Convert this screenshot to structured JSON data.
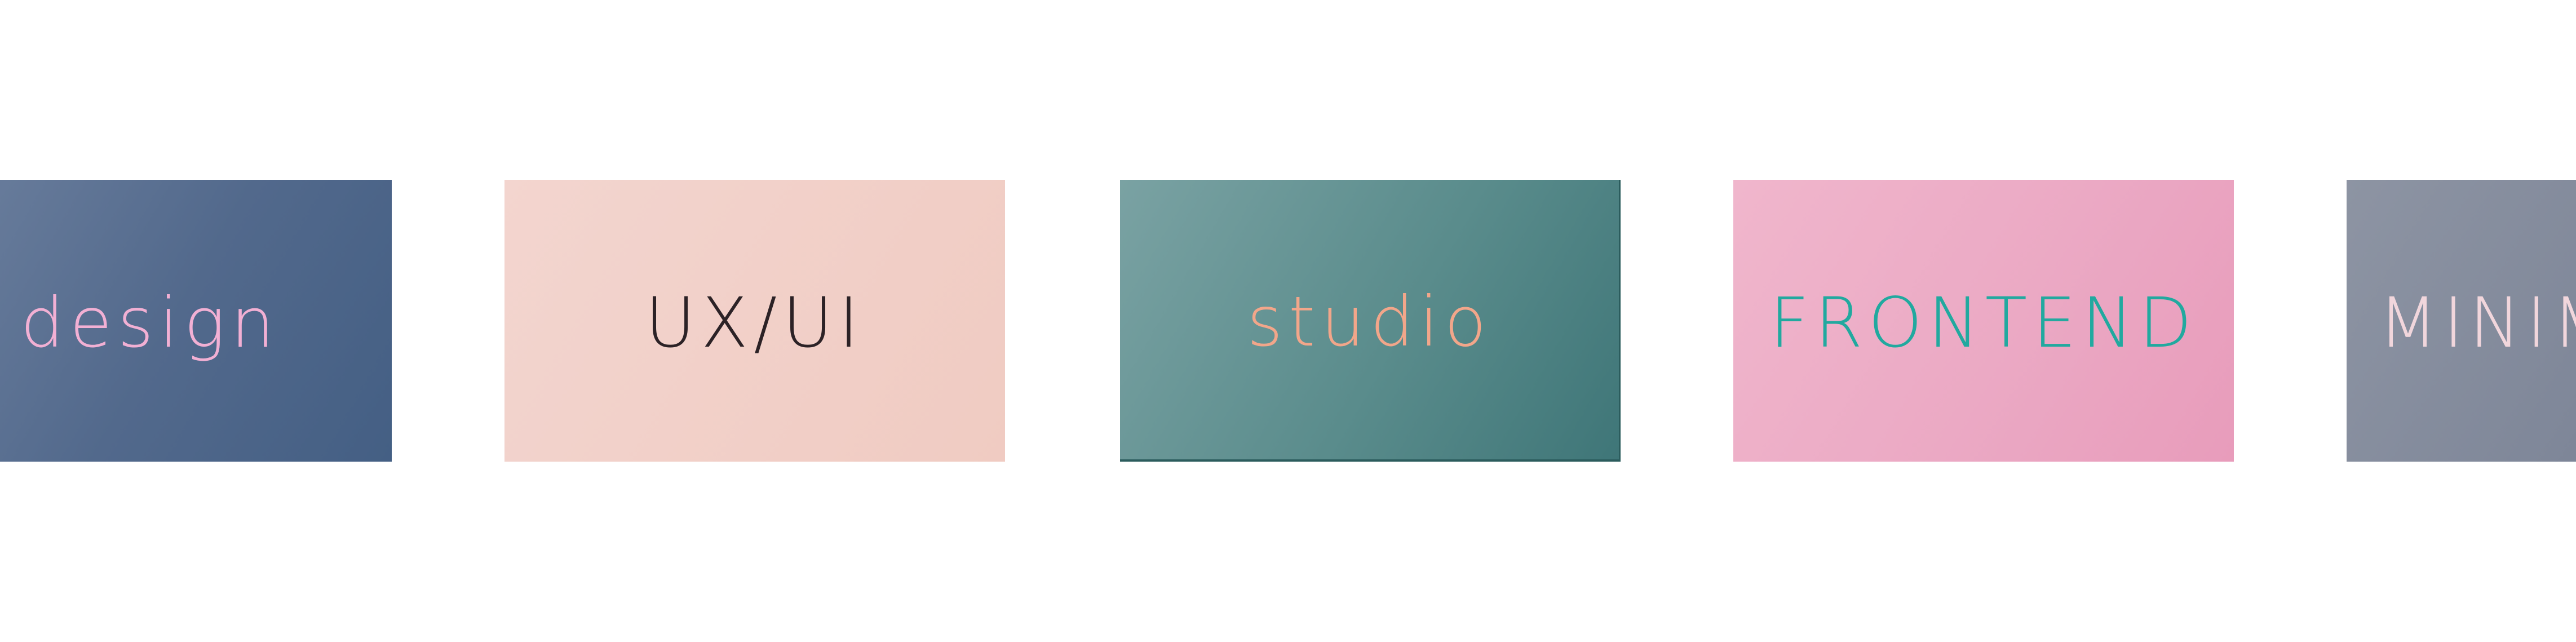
{
  "tiles": [
    {
      "label": "web design",
      "text_color": "#f2b0d4",
      "background": "#52698c"
    },
    {
      "label": "UX/UI",
      "text_color": "#2c2226",
      "background": "#f1cfc7"
    },
    {
      "label": "studio",
      "text_color": "#f2a68a",
      "background": "#5a8c8c"
    },
    {
      "label": "FRONTEND",
      "text_color": "#21a99f",
      "background": "#eba9c4"
    },
    {
      "label": "MINIMAL",
      "text_color": "#f1d6dc",
      "background": "#7f8799"
    }
  ]
}
